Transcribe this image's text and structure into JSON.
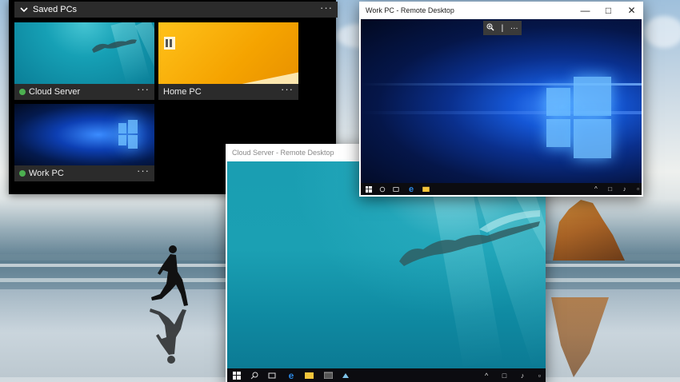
{
  "saved_pcs": {
    "title": "Saved PCs",
    "more": "···",
    "tiles": [
      {
        "name": "Cloud Server",
        "status": "online",
        "more": "···"
      },
      {
        "name": "Home PC",
        "more": "···"
      },
      {
        "name": "Work PC",
        "status": "online",
        "more": "···"
      }
    ]
  },
  "work_window": {
    "title": "Work PC - Remote Desktop",
    "minimize": "—",
    "maximize": "□",
    "close": "✕",
    "zoom_bar": {
      "zoom_icon": "zoom-in-icon",
      "separator": "|",
      "more": "···"
    }
  },
  "cloud_window": {
    "title": "Cloud Server - Remote Desktop"
  },
  "taskbar_icons": [
    "windows-start-icon",
    "search-icon",
    "task-view-icon",
    "edge-icon",
    "file-explorer-icon",
    "store-icon",
    "app-icon"
  ],
  "colors": {
    "panel_bg": "#000000",
    "tile_bar": "#2b2b2b",
    "status_online": "#4caf50",
    "taskbar": "#0c0c10",
    "edge_blue": "#2b87e3",
    "explorer_yellow": "#f3c53b"
  }
}
